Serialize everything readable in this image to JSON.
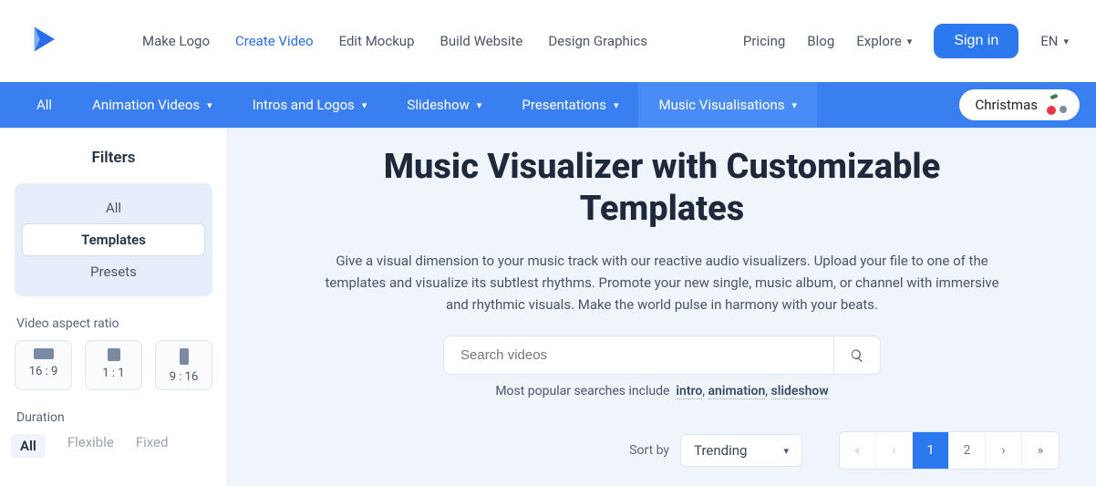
{
  "header": {
    "nav": [
      "Make Logo",
      "Create Video",
      "Edit Mockup",
      "Build Website",
      "Design Graphics"
    ],
    "active_index": 1,
    "pricing": "Pricing",
    "blog": "Blog",
    "explore": "Explore",
    "signin": "Sign in",
    "lang": "EN"
  },
  "categories": {
    "items": [
      "All",
      "Animation Videos",
      "Intros and Logos",
      "Slideshow",
      "Presentations",
      "Music Visualisations"
    ],
    "active_index": 5,
    "special": "Christmas"
  },
  "sidebar": {
    "title": "Filters",
    "tabs": {
      "all": "All",
      "templates": "Templates",
      "presets": "Presets",
      "selected": "templates"
    },
    "ratio_label": "Video aspect ratio",
    "ratios": [
      "16 : 9",
      "1 : 1",
      "9 : 16"
    ],
    "duration_label": "Duration",
    "durations": [
      "All",
      "Flexible",
      "Fixed"
    ],
    "duration_selected": 0
  },
  "main": {
    "title": "Music Visualizer with Customizable Templates",
    "description": "Give a visual dimension to your music track with our reactive audio visualizers. Upload your file to one of the templates and visualize its subtlest rhythms. Promote your new single, music album, or channel with immersive and rhythmic visuals. Make the world pulse in harmony with your beats.",
    "search_placeholder": "Search videos",
    "popular_prefix": "Most popular searches include",
    "popular": [
      "intro",
      "animation",
      "slideshow"
    ],
    "sort_label": "Sort by",
    "sort_value": "Trending",
    "pages": [
      "1",
      "2"
    ],
    "active_page": 0
  }
}
